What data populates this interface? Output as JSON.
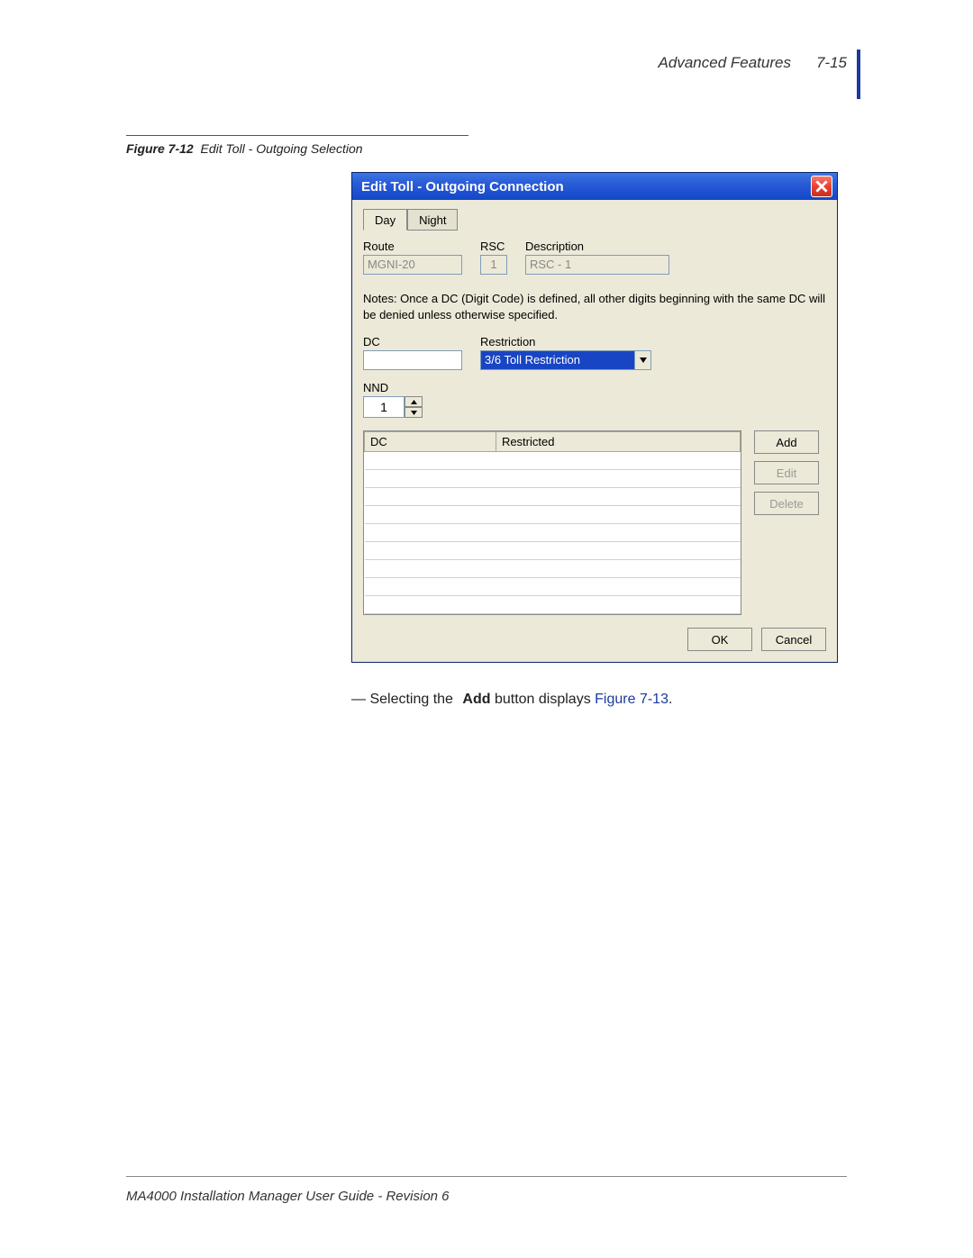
{
  "header": {
    "section": "Advanced Features",
    "page": "7-15"
  },
  "figure": {
    "label": "Figure 7-12",
    "title": "Edit Toll - Outgoing Selection"
  },
  "dialog": {
    "title": "Edit Toll - Outgoing Connection",
    "tabs": {
      "day": "Day",
      "night": "Night"
    },
    "labels": {
      "route": "Route",
      "rsc": "RSC",
      "description": "Description",
      "dc": "DC",
      "restriction": "Restriction",
      "nnd": "NND"
    },
    "values": {
      "route": "MGNI-20",
      "rsc": "1",
      "description": "RSC - 1",
      "restriction_selected": "3/6 Toll Restriction",
      "nnd": "1"
    },
    "note": "Notes: Once a DC (Digit Code) is defined, all other digits beginning with the same DC will be denied unless otherwise specified.",
    "table": {
      "cols": {
        "dc": "DC",
        "restricted": "Restricted"
      }
    },
    "buttons": {
      "add": "Add",
      "edit": "Edit",
      "delete": "Delete",
      "ok": "OK",
      "cancel": "Cancel"
    }
  },
  "body": {
    "line_prefix": "— Selecting the ",
    "bold": "Add",
    "line_mid": " button displays ",
    "figref": "Figure 7-13",
    "line_suffix": "."
  },
  "footer": "MA4000 Installation Manager User Guide - Revision 6"
}
